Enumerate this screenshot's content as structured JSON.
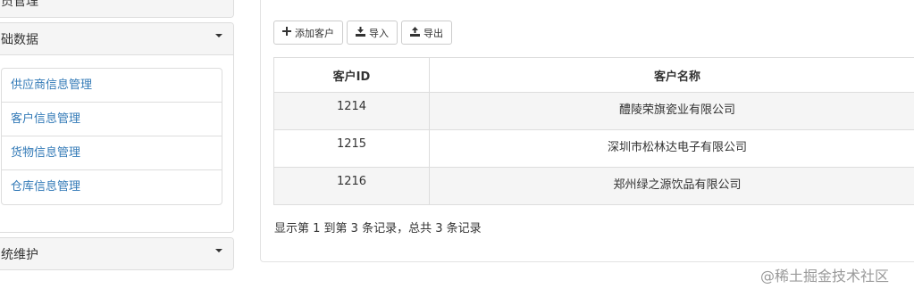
{
  "sidebar": {
    "panel_top": {
      "title": "员管理"
    },
    "panel_basic": {
      "title": "础数据",
      "items": [
        {
          "label": "供应商信息管理"
        },
        {
          "label": "客户信息管理"
        },
        {
          "label": "货物信息管理"
        },
        {
          "label": "仓库信息管理"
        }
      ]
    },
    "panel_system": {
      "title": "统维护"
    }
  },
  "toolbar": {
    "add_label": "添加客户",
    "import_label": "导入",
    "export_label": "导出",
    "add_icon": "plus-icon",
    "import_icon": "import-icon",
    "export_icon": "export-icon"
  },
  "table": {
    "columns": [
      "客户ID",
      "客户名称"
    ],
    "rows": [
      {
        "id": "1214",
        "name": "醴陵荣旗瓷业有限公司"
      },
      {
        "id": "1215",
        "name": "深圳市松林达电子有限公司"
      },
      {
        "id": "1216",
        "name": "郑州绿之源饮品有限公司"
      }
    ]
  },
  "pagination": {
    "info": "显示第 1 到第 3 条记录，总共 3 条记录"
  },
  "watermark": {
    "text": "@稀土掘金技术社区"
  }
}
